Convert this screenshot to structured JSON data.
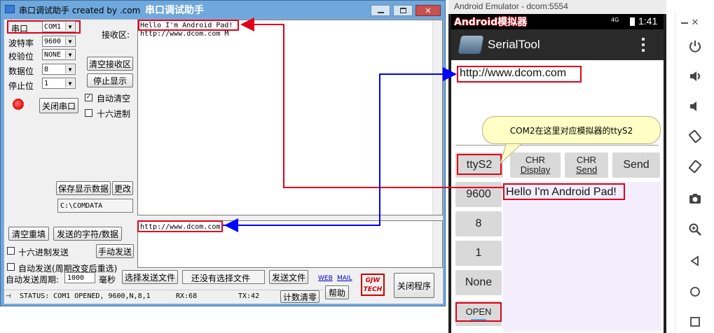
{
  "serial_app": {
    "title": "串口调试助手 created by .com",
    "annotation": "串口调试助手",
    "labels": {
      "port": "串口",
      "baud": "波特率",
      "parity": "校验位",
      "databits": "数据位",
      "stopbits": "停止位",
      "receive": "接收区:"
    },
    "values": {
      "port": "COM1",
      "baud": "9600",
      "parity": "NONE",
      "databits": "8",
      "stopbits": "1"
    },
    "buttons": {
      "close_port": "关闭串口",
      "clear_receive": "清空接收区",
      "stop_display": "停止显示",
      "save_data": "保存显示数据",
      "change": "更改",
      "clear_fill": "清空重填",
      "sent_data": "发送的字符/数据",
      "manual_send": "手动发送",
      "choose_file": "选择发送文件",
      "send_file": "发送文件",
      "help": "帮助",
      "reset_count": "计数清零",
      "exit": "关闭程序"
    },
    "checkboxes": {
      "auto_clear": "自动清空",
      "hex_display": "十六进制",
      "hex_send": "十六进制发送",
      "auto_send": "自动发送(周期改变后重选)"
    },
    "auto_clear_checked": "✓",
    "send_period_label": "自动发送周期:",
    "send_period_value": "1000",
    "send_period_unit": "毫秒",
    "save_path": "C:\\COMDATA",
    "no_file": "还没有选择文件",
    "receive_lines": [
      "Hello I'm Android Pad!",
      "http://www.dcom.com M"
    ],
    "send_text": "http://www.dcom.com",
    "links": {
      "web": "WEB",
      "mail": "MAIL"
    },
    "logo": "GJW TECH",
    "status": {
      "main": "STATUS: COM1 OPENED, 9600,N,8,1",
      "rx": "RX:68",
      "tx": "TX:42"
    }
  },
  "emulator": {
    "window_title": "Android Emulator - dcom:5554",
    "annotation": "Android模拟器",
    "clock": "1:41",
    "signal": "4G",
    "app_title": "SerialTool",
    "url_text": "http://www.dcom.com",
    "tooltip": "COM2在这里对应模拟器的ttyS2",
    "buttons": {
      "port": "ttyS2",
      "chr_display_1": "CHR",
      "chr_display_2": "Display",
      "chr_send_1": "CHR",
      "chr_send_2": "Send",
      "send": "Send",
      "baud": "9600",
      "databits": "8",
      "stopbits": "1",
      "parity": "None",
      "open": "OPEN"
    },
    "send_field": "Hello I'm Android Pad!"
  },
  "colors": {
    "annotation_red": "#e0001a",
    "arrow_blue": "#0000ff",
    "title_blue": "#6fa8dc",
    "tooltip_bg": "#ffffc6",
    "android_bar": "#2a2a2a"
  }
}
